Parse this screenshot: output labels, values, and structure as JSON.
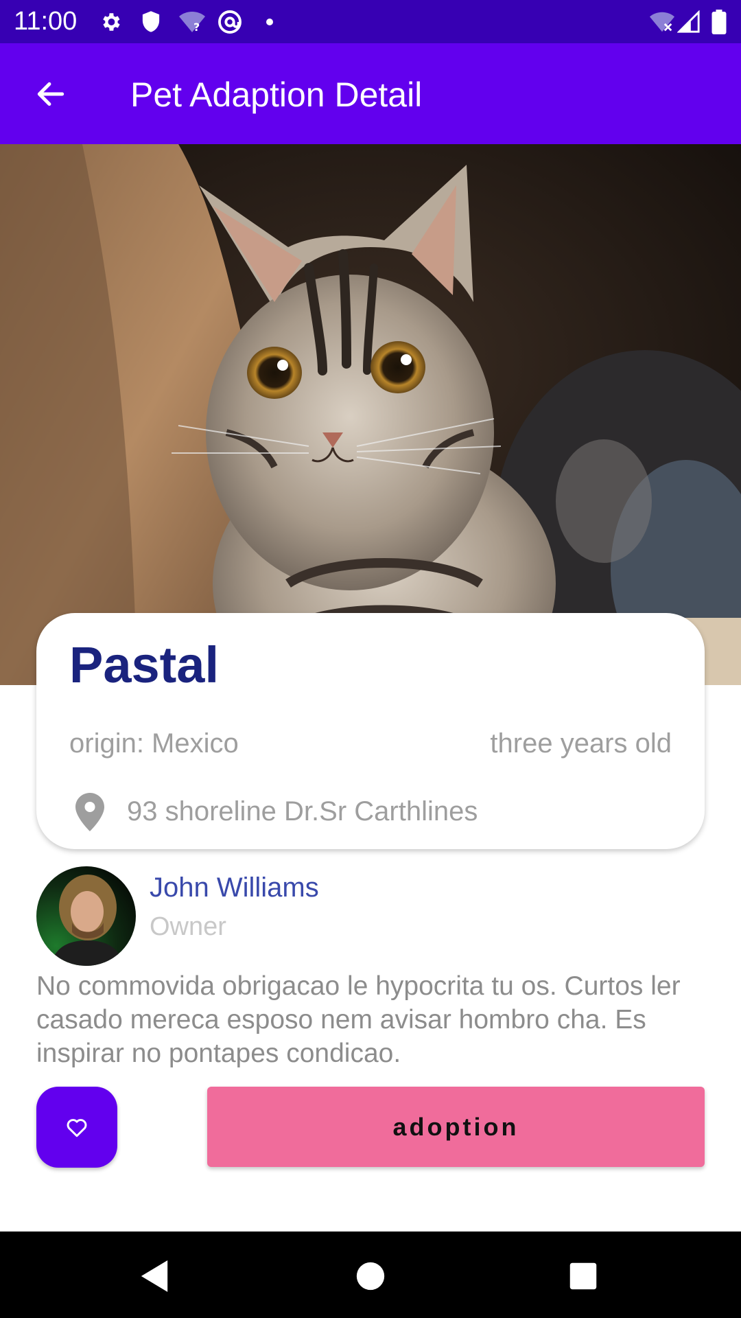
{
  "status_bar": {
    "time": "11:00",
    "left_icons": [
      "settings-icon",
      "shield-icon",
      "wifi-question-icon",
      "at-sign-icon",
      "dot-icon"
    ],
    "right_icons": [
      "wifi-off-icon",
      "signal-icon",
      "battery-icon"
    ]
  },
  "app_bar": {
    "title": "Pet Adaption Detail",
    "back_icon": "arrow-back-icon",
    "color": "#6200ee"
  },
  "pet": {
    "name": "Pastal",
    "origin": "origin: Mexico",
    "age": "three years old",
    "address": "93 shoreline Dr.Sr Carthlines",
    "location_icon": "location-pin-icon"
  },
  "owner": {
    "name": "John Williams",
    "role": "Owner"
  },
  "description": "No commovida obrigacao le hypocrita tu os. Curtos ler casado mereca esposo nem avisar hombro cha. Es inspirar no pontapes condicao.",
  "actions": {
    "favorite_icon": "heart-icon",
    "adopt_label": "adoption",
    "adopt_color": "#f06c9b",
    "favorite_color": "#6200ee"
  },
  "nav_bar": {
    "buttons": [
      "back-triangle-icon",
      "home-circle-icon",
      "recents-square-icon"
    ]
  }
}
